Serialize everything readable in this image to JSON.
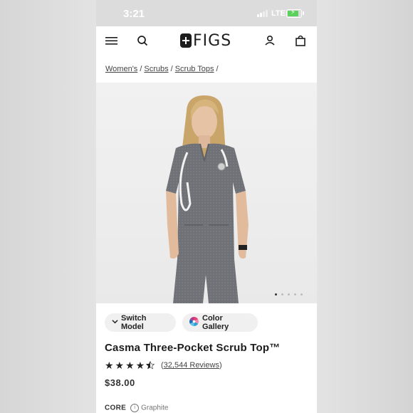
{
  "status_bar": {
    "time": "3:21",
    "network": "LTE",
    "battery_fill_fraction": 0.9
  },
  "header": {
    "logo_text": "FIGS",
    "menu_icon": "hamburger-menu-icon",
    "search_icon": "search-icon",
    "account_icon": "user-icon",
    "cart_icon": "shopping-bag-icon"
  },
  "breadcrumb": {
    "items": [
      "Women's",
      "Scrubs",
      "Scrub Tops"
    ],
    "separator": "/"
  },
  "gallery": {
    "total_images": 5,
    "active_index": 0
  },
  "actions": {
    "switch_model": "Switch Model",
    "color_gallery": "Color Gallery"
  },
  "product": {
    "title": "Casma Three-Pocket Scrub Top™",
    "rating": 4.5,
    "stars": "★★★★",
    "reviews_open": "(",
    "reviews_text": "32,544 Reviews",
    "reviews_close": ")",
    "price": "$38.00",
    "collection_label": "CORE",
    "color_name": "Graphite"
  },
  "colors": {
    "scrub": "#6f7176",
    "background": "#ececec",
    "text": "#1c1c1c"
  }
}
